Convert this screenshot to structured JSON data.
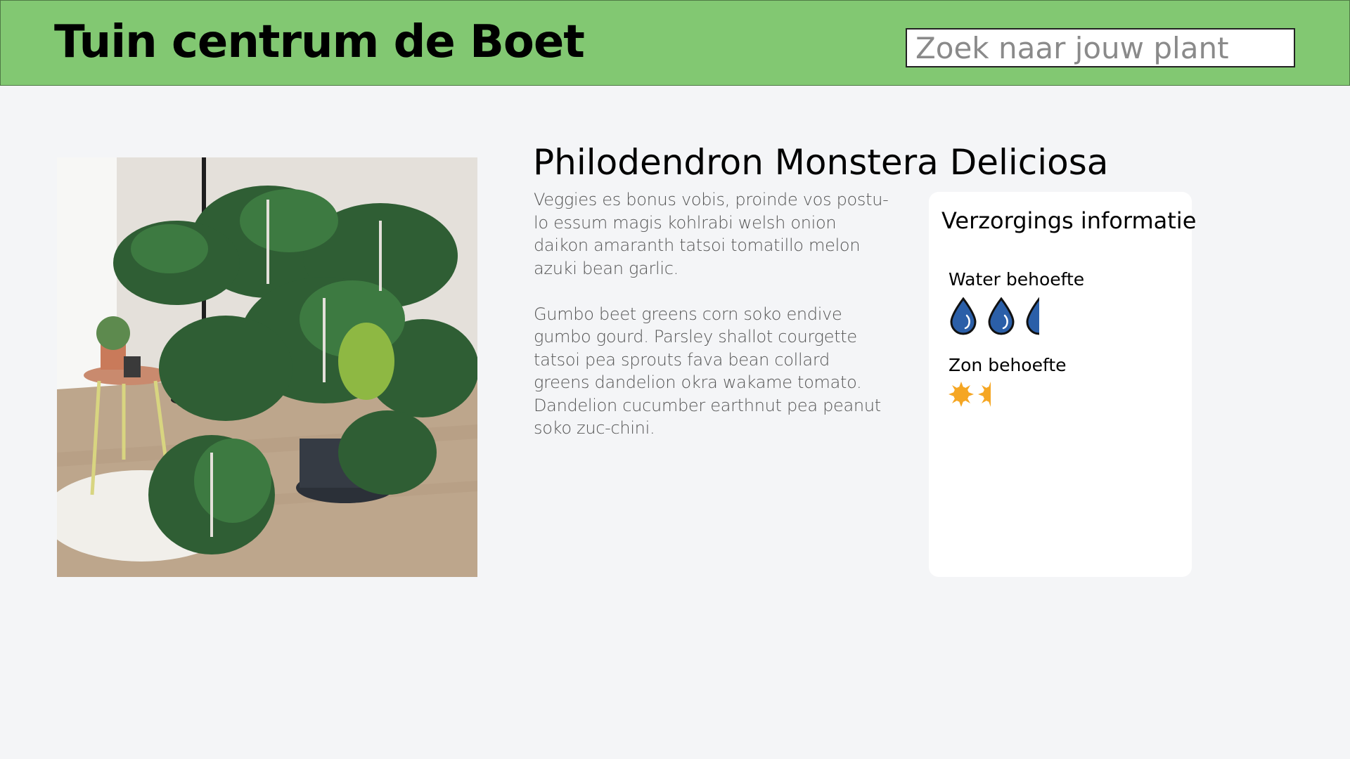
{
  "header": {
    "site_title": "Tuin centrum de Boet",
    "search_placeholder": "Zoek naar jouw plant"
  },
  "product": {
    "name": "Philodendron Monstera Deliciosa",
    "description": [
      "Veggies es bonus vobis, proinde vos postu-lo essum magis kohlrabi welsh onion daikon amaranth tatsoi tomatillo melon azuki bean garlic.",
      "Gumbo beet greens corn soko endive gumbo gourd. Parsley shallot courgette tatsoi pea sprouts fava bean collard greens dandelion okra wakame tomato. Dandelion cucumber earthnut pea peanut soko zuc-chini."
    ]
  },
  "care": {
    "title": "Verzorgings informatie",
    "water_label": "Water behoefte",
    "water_level": 2.5,
    "water_max": 3,
    "water_icon": "water-drop-icon",
    "sun_label": "Zon behoefte",
    "sun_level": 1.5,
    "sun_max": 2,
    "sun_icon": "sun-icon"
  },
  "colors": {
    "header_bg": "#82c872",
    "page_bg": "#f4f5f7",
    "drop_fill": "#2b5fa8",
    "sun_fill": "#f5a623"
  }
}
